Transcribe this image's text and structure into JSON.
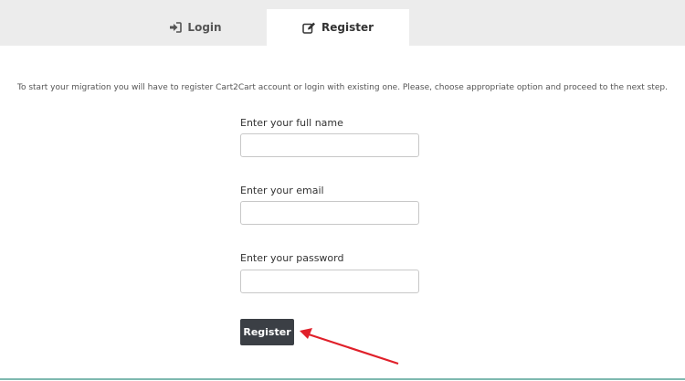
{
  "tabs": {
    "login": {
      "label": "Login",
      "icon": "sign-in-icon",
      "active": false
    },
    "register": {
      "label": "Register",
      "icon": "edit-icon",
      "active": true
    }
  },
  "intro_text": "To start your migration you will have to register Cart2Cart account or login with existing one. Please, choose appropriate option and proceed to the next step.",
  "form": {
    "full_name": {
      "label": "Enter your full name",
      "value": "",
      "placeholder": ""
    },
    "email": {
      "label": "Enter your email",
      "value": "",
      "placeholder": ""
    },
    "password": {
      "label": "Enter your password",
      "value": "",
      "placeholder": ""
    },
    "submit_label": "Register"
  },
  "colors": {
    "tabbar_bg": "#ececec",
    "button_bg": "#3b3f45",
    "annotation_arrow": "#e0202a",
    "bottom_border": "#7fb9b0"
  }
}
